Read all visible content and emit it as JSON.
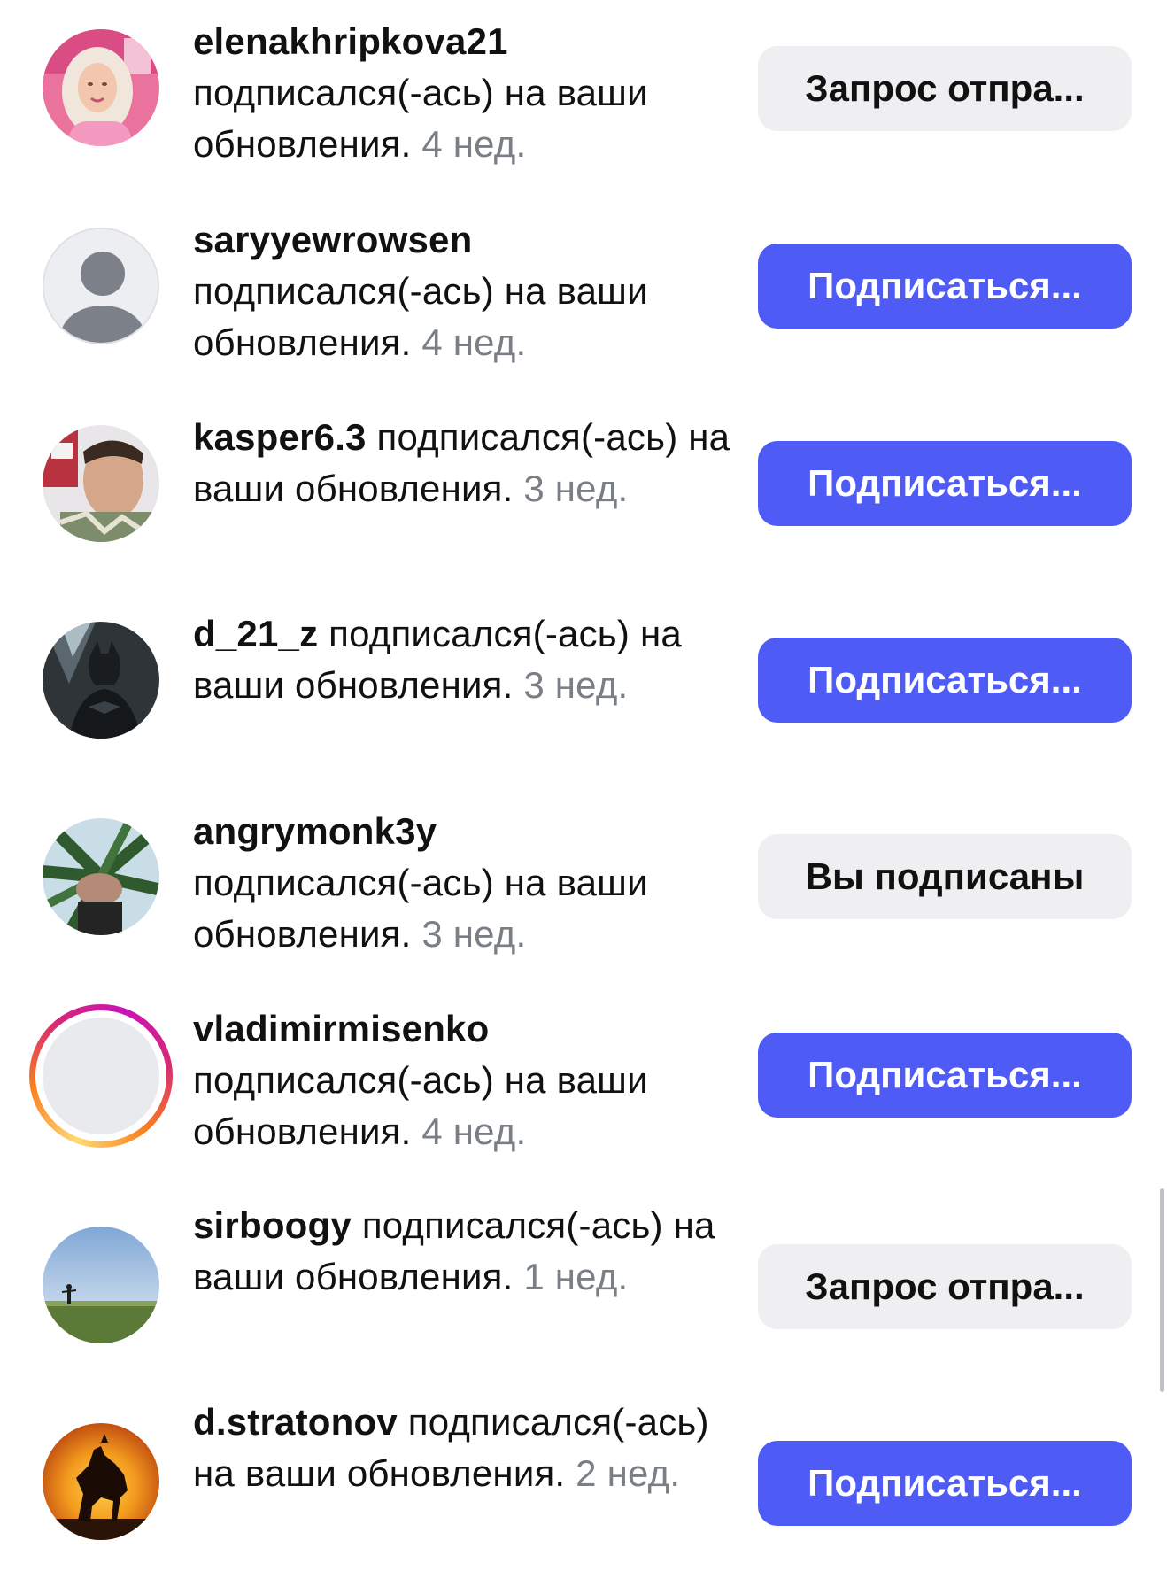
{
  "notifications": [
    {
      "username": "elenakhripkova21",
      "text": "подписался(-ась) на ваши обновления.",
      "time": "4 нед.",
      "button": "Запрос отпра...",
      "button_style": "secondary",
      "avatar": "photo-woman-pink"
    },
    {
      "username": "saryyewrowsen",
      "text": "подписался(-ась) на ваши обновления.",
      "time": "4 нед.",
      "button": "Подписаться...",
      "button_style": "primary",
      "avatar": "default-user-icon"
    },
    {
      "username": "kasper6.3",
      "text": "подписался(-ась) на ваши обновления.",
      "time": "3 нед.",
      "button": "Подписаться...",
      "button_style": "primary",
      "avatar": "photo-man-selfie"
    },
    {
      "username": "d_21_z",
      "text": "подписался(-ась) на ваши обновления.",
      "time": "3 нед.",
      "button": "Подписаться...",
      "button_style": "primary",
      "avatar": "photo-batman"
    },
    {
      "username": "angrymonk3y",
      "text": "подписался(-ась) на ваши обновления.",
      "time": "3 нед.",
      "button": "Вы подписаны",
      "button_style": "secondary",
      "avatar": "photo-palm-trees"
    },
    {
      "username": "vladimirmisenko",
      "text": "подписался(-ась) на ваши обновления.",
      "time": "4 нед.",
      "button": "Подписаться...",
      "button_style": "primary",
      "avatar": "story-ring-blank"
    },
    {
      "username": "sirboogy",
      "text": "подписался(-ась) на ваши обновления.",
      "time": "1 нед.",
      "button": "Запрос отпра...",
      "button_style": "secondary",
      "avatar": "photo-field-sky"
    },
    {
      "username": "d.stratonov",
      "text": "подписался(-ась) на ваши обновления.",
      "time": "2 нед.",
      "button": "Подписаться...",
      "button_style": "primary",
      "avatar": "photo-horse-sunset"
    }
  ],
  "colors": {
    "primary_button": "#4f5bf5",
    "secondary_button": "#efeff2",
    "timestamp": "#7a7f86"
  }
}
